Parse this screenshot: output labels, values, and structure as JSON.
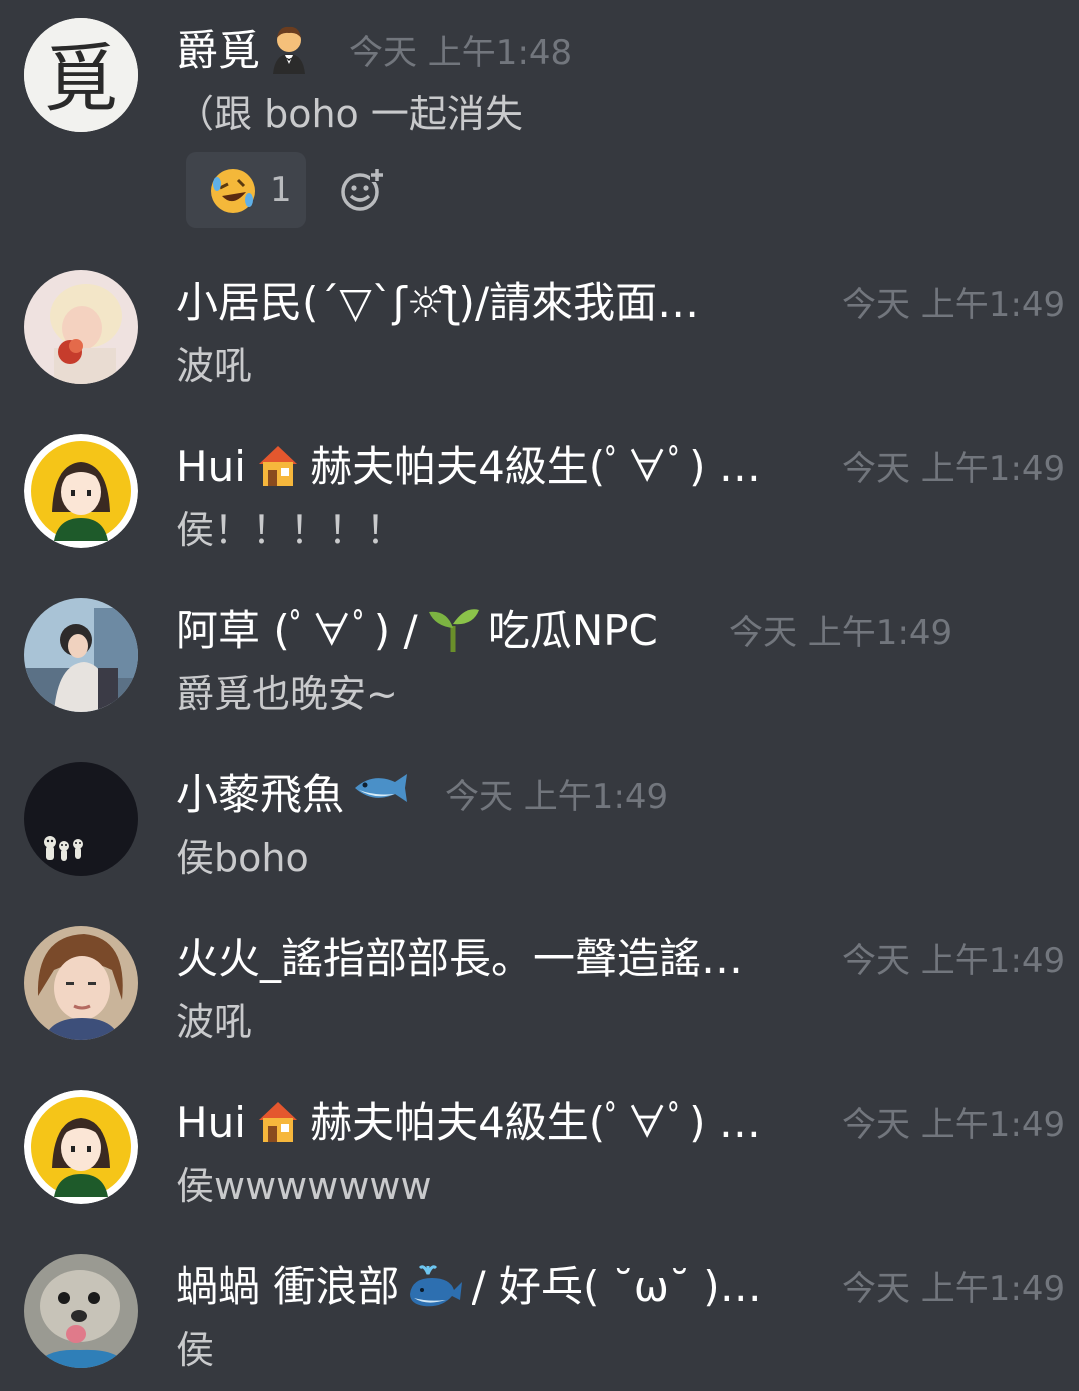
{
  "messages": [
    {
      "name": "爵覓",
      "time": "今天 上午1:48",
      "text": "（跟 boho 一起消失",
      "reaction": {
        "emoji": "rofl-emoji",
        "count": "1"
      }
    },
    {
      "name": "小居民(´▽`ʃ☼ƪ)/請來我面…",
      "time": "今天 上午1:49",
      "text": "波吼"
    },
    {
      "name_prefix": "Hui",
      "name_suffix": "赫夫帕夫4級生(ﾟ∀ﾟ) …",
      "time": "今天 上午1:49",
      "text": "侯！！！！！"
    },
    {
      "name_prefix": "阿草 (ﾟ∀ﾟ) /",
      "name_suffix": "吃瓜NPC",
      "time": "今天 上午1:49",
      "text": "爵覓也晚安~"
    },
    {
      "name": "小藜飛魚",
      "time": "今天 上午1:49",
      "text": "侯boho"
    },
    {
      "name": "火火_謠指部部長。一聲造謠…",
      "time": "今天 上午1:49",
      "text": "波吼"
    },
    {
      "name_prefix": "Hui",
      "name_suffix": "赫夫帕夫4級生(ﾟ∀ﾟ) …",
      "time": "今天 上午1:49",
      "text": "侯wwwwwww"
    },
    {
      "name_prefix": "蝸蝸 衝浪部",
      "name_suffix": "/ 好乓( ˘ω˘ )…",
      "time": "今天 上午1:49",
      "text": "侯"
    }
  ],
  "icons": {
    "m0_name": "man-in-tuxedo-emoji",
    "m2_name": "house-emoji",
    "m3_name": "seedling-emoji",
    "m4_name": "fish-emoji",
    "m7_name": "whale-emoji",
    "add_reaction": "add-reaction-icon"
  },
  "colors": {
    "background": "#36393f",
    "username": "#ffffff",
    "timestamp": "#72767d",
    "message_text": "#c9cacc",
    "reaction_bg": "#40444b"
  }
}
